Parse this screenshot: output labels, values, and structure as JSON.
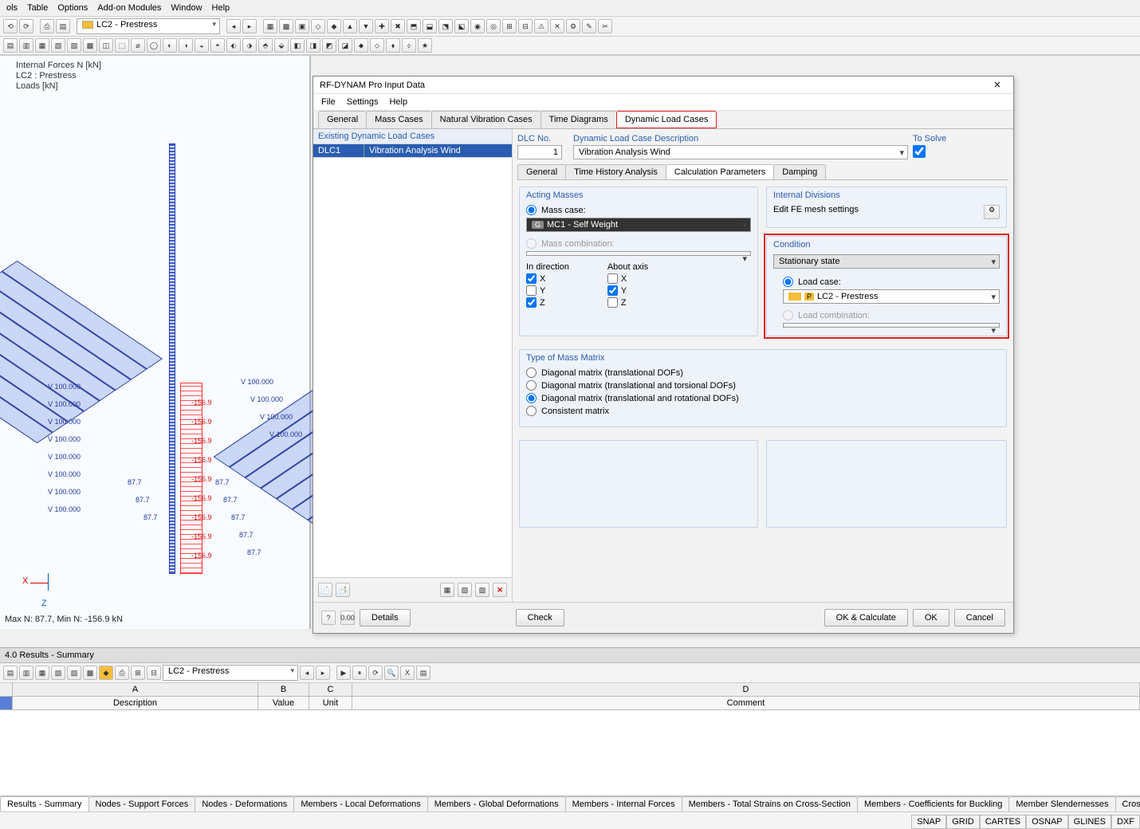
{
  "menu": [
    "ols",
    "Table",
    "Options",
    "Add-on Modules",
    "Window",
    "Help"
  ],
  "toolbar1": {
    "loadcase_label": "LC2 - Prestress"
  },
  "canvas": {
    "line1": "Internal Forces N [kN]",
    "line2": "LC2 : Prestress",
    "line3": "Loads [kN]",
    "minmax": "Max N: 87.7, Min N: -156.9 kN",
    "axis_x": "X",
    "axis_z": "Z",
    "blue_val1": "V 100.000",
    "blue_val2": "87.7",
    "red_val": "-156.9"
  },
  "dialog": {
    "title": "RF-DYNAM Pro Input Data",
    "menu": [
      "File",
      "Settings",
      "Help"
    ],
    "tabs": [
      "General",
      "Mass Cases",
      "Natural Vibration Cases",
      "Time Diagrams",
      "Dynamic Load Cases"
    ],
    "activeTab": 4,
    "left": {
      "header": "Existing Dynamic Load Cases",
      "dlc_id": "DLC1",
      "dlc_name": "Vibration Analysis Wind"
    },
    "dlcno": {
      "label": "DLC No.",
      "value": "1"
    },
    "dlcdesc": {
      "label": "Dynamic Load Case Description",
      "value": "Vibration Analysis Wind"
    },
    "tosolve": {
      "label": "To Solve",
      "checked": true
    },
    "subtabs": [
      "General",
      "Time History Analysis",
      "Calculation Parameters",
      "Damping"
    ],
    "activeSub": 2,
    "actingMasses": {
      "legend": "Acting Masses",
      "masscase": "Mass case:",
      "masscase_sel": "MC1 - Self Weight",
      "masscomb": "Mass combination:",
      "indir": "In direction",
      "aboutaxis": "About axis",
      "x": "X",
      "y": "Y",
      "z": "Z",
      "dir": {
        "x": true,
        "y": false,
        "z": true
      },
      "axis": {
        "x": false,
        "y": true,
        "z": false
      }
    },
    "internalDiv": {
      "legend": "Internal Divisions",
      "text": "Edit FE mesh settings"
    },
    "condition": {
      "legend": "Condition",
      "state": "Stationary state",
      "loadcase_label": "Load case:",
      "loadcase": "LC2 - Prestress",
      "loadcomb": "Load combination:"
    },
    "massmatrix": {
      "legend": "Type of Mass Matrix",
      "opt1": "Diagonal matrix (translational DOFs)",
      "opt2": "Diagonal matrix (translational and torsional DOFs)",
      "opt3": "Diagonal matrix (translational and rotational DOFs)",
      "opt4": "Consistent matrix",
      "selected": 2
    },
    "foot": {
      "details": "Details",
      "check": "Check",
      "okcalc": "OK & Calculate",
      "ok": "OK",
      "cancel": "Cancel"
    }
  },
  "bottom": {
    "title": "4.0 Results - Summary",
    "loadcase": "LC2 - Prestress",
    "cols": {
      "A": "A",
      "B": "B",
      "C": "C",
      "D": "D"
    },
    "cols2": {
      "A": "Description",
      "B": "Value",
      "C": "Unit",
      "D": "Comment"
    },
    "tabs": [
      "Results - Summary",
      "Nodes - Support Forces",
      "Nodes - Deformations",
      "Members - Local Deformations",
      "Members - Global Deformations",
      "Members - Internal Forces",
      "Members - Total Strains on Cross-Section",
      "Members - Coefficients for Buckling",
      "Member Slendernesses",
      "Cross-Sections - Internal Forces"
    ],
    "activeTab": 0
  },
  "status": [
    "SNAP",
    "GRID",
    "CARTES",
    "OSNAP",
    "GLINES",
    "DXF"
  ]
}
